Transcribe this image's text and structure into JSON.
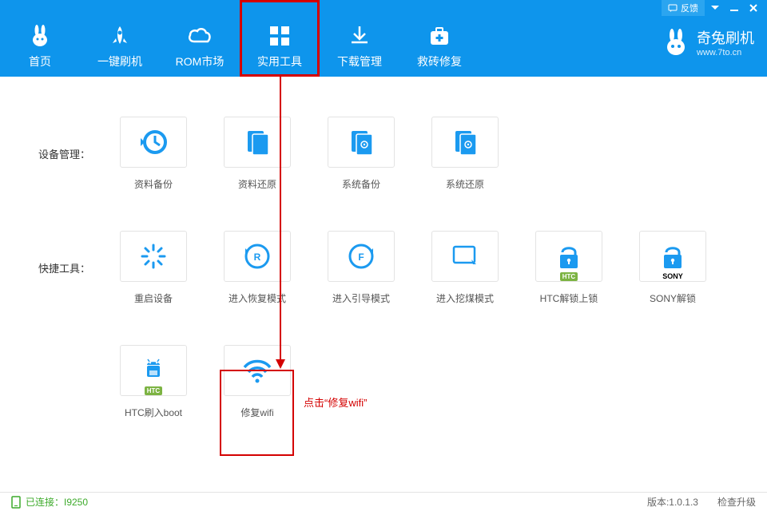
{
  "titlebar": {
    "feedback": "反馈"
  },
  "nav": {
    "items": [
      {
        "label": "首页"
      },
      {
        "label": "一键刷机"
      },
      {
        "label": "ROM市场"
      },
      {
        "label": "实用工具"
      },
      {
        "label": "下载管理"
      },
      {
        "label": "救砖修复"
      }
    ]
  },
  "brand": {
    "title": "奇兔刷机",
    "url": "www.7to.cn"
  },
  "sections": {
    "device_mgmt": {
      "label": "设备管理：",
      "tools": [
        {
          "label": "资料备份"
        },
        {
          "label": "资料还原"
        },
        {
          "label": "系统备份"
        },
        {
          "label": "系统还原"
        }
      ]
    },
    "quick_tools": {
      "label": "快捷工具：",
      "tools": [
        {
          "label": "重启设备"
        },
        {
          "label": "进入恢复模式"
        },
        {
          "label": "进入引导模式"
        },
        {
          "label": "进入挖煤模式"
        },
        {
          "label": "HTC解锁上锁"
        },
        {
          "label": "SONY解锁"
        }
      ]
    },
    "extra": {
      "tools": [
        {
          "label": "HTC刷入boot"
        },
        {
          "label": "修复wifi"
        }
      ]
    }
  },
  "annotation": "点击“修复wifi”",
  "statusbar": {
    "connected": "已连接：I9250",
    "version": "版本:1.0.1.3",
    "check_update": "检查升级"
  },
  "badges": {
    "htc": "HTC",
    "sony": "SONY"
  }
}
